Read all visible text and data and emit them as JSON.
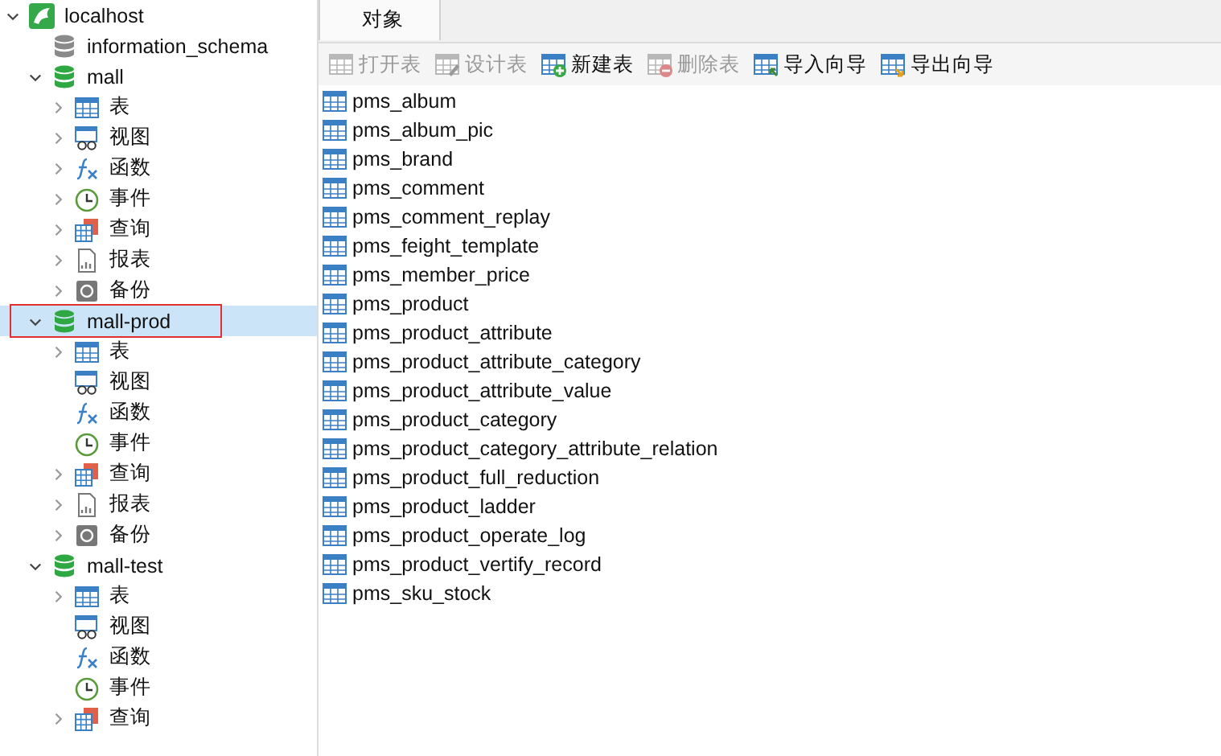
{
  "tree": [
    {
      "label": "localhost",
      "kind": "server",
      "expanded": true,
      "expandable": true,
      "selected": false,
      "children": [
        {
          "label": "information_schema",
          "kind": "database",
          "open": false,
          "expandable": false,
          "selected": false
        },
        {
          "label": "mall",
          "kind": "database",
          "open": true,
          "expandable": true,
          "expanded": true,
          "selected": false,
          "children": [
            {
              "label": "表",
              "kind": "table",
              "expandable": true,
              "expanded": false,
              "selected": false
            },
            {
              "label": "视图",
              "kind": "view",
              "expandable": true,
              "expanded": false,
              "selected": false
            },
            {
              "label": "函数",
              "kind": "function",
              "expandable": true,
              "expanded": false,
              "selected": false
            },
            {
              "label": "事件",
              "kind": "event",
              "expandable": true,
              "expanded": false,
              "selected": false
            },
            {
              "label": "查询",
              "kind": "query",
              "expandable": true,
              "expanded": false,
              "selected": false
            },
            {
              "label": "报表",
              "kind": "report",
              "expandable": true,
              "expanded": false,
              "selected": false
            },
            {
              "label": "备份",
              "kind": "backup",
              "expandable": true,
              "expanded": false,
              "selected": false
            }
          ]
        },
        {
          "label": "mall-prod",
          "kind": "database",
          "open": true,
          "expandable": true,
          "expanded": true,
          "selected": true,
          "highlighted": true,
          "children": [
            {
              "label": "表",
              "kind": "table",
              "expandable": true,
              "expanded": false,
              "selected": false
            },
            {
              "label": "视图",
              "kind": "view",
              "expandable": false,
              "selected": false
            },
            {
              "label": "函数",
              "kind": "function",
              "expandable": false,
              "selected": false
            },
            {
              "label": "事件",
              "kind": "event",
              "expandable": false,
              "selected": false
            },
            {
              "label": "查询",
              "kind": "query",
              "expandable": true,
              "expanded": false,
              "selected": false
            },
            {
              "label": "报表",
              "kind": "report",
              "expandable": true,
              "expanded": false,
              "selected": false
            },
            {
              "label": "备份",
              "kind": "backup",
              "expandable": true,
              "expanded": false,
              "selected": false
            }
          ]
        },
        {
          "label": "mall-test",
          "kind": "database",
          "open": true,
          "expandable": true,
          "expanded": true,
          "selected": false,
          "children": [
            {
              "label": "表",
              "kind": "table",
              "expandable": true,
              "expanded": false,
              "selected": false
            },
            {
              "label": "视图",
              "kind": "view",
              "expandable": false,
              "selected": false
            },
            {
              "label": "函数",
              "kind": "function",
              "expandable": false,
              "selected": false
            },
            {
              "label": "事件",
              "kind": "event",
              "expandable": false,
              "selected": false
            },
            {
              "label": "查询",
              "kind": "query",
              "expandable": true,
              "expanded": false,
              "selected": false
            }
          ]
        }
      ]
    }
  ],
  "tabs": [
    {
      "label": "对象",
      "selected": true
    }
  ],
  "toolbar": [
    {
      "label": "打开表",
      "kind": "open",
      "disabled": true
    },
    {
      "label": "设计表",
      "kind": "design",
      "disabled": true
    },
    {
      "label": "新建表",
      "kind": "new",
      "disabled": false
    },
    {
      "label": "删除表",
      "kind": "delete",
      "disabled": true
    },
    {
      "label": "导入向导",
      "kind": "import",
      "disabled": false
    },
    {
      "label": "导出向导",
      "kind": "export",
      "disabled": false
    }
  ],
  "objects": [
    "pms_album",
    "pms_album_pic",
    "pms_brand",
    "pms_comment",
    "pms_comment_replay",
    "pms_feight_template",
    "pms_member_price",
    "pms_product",
    "pms_product_attribute",
    "pms_product_attribute_category",
    "pms_product_attribute_value",
    "pms_product_category",
    "pms_product_category_attribute_relation",
    "pms_product_full_reduction",
    "pms_product_ladder",
    "pms_product_operate_log",
    "pms_product_vertify_record",
    "pms_sku_stock"
  ]
}
